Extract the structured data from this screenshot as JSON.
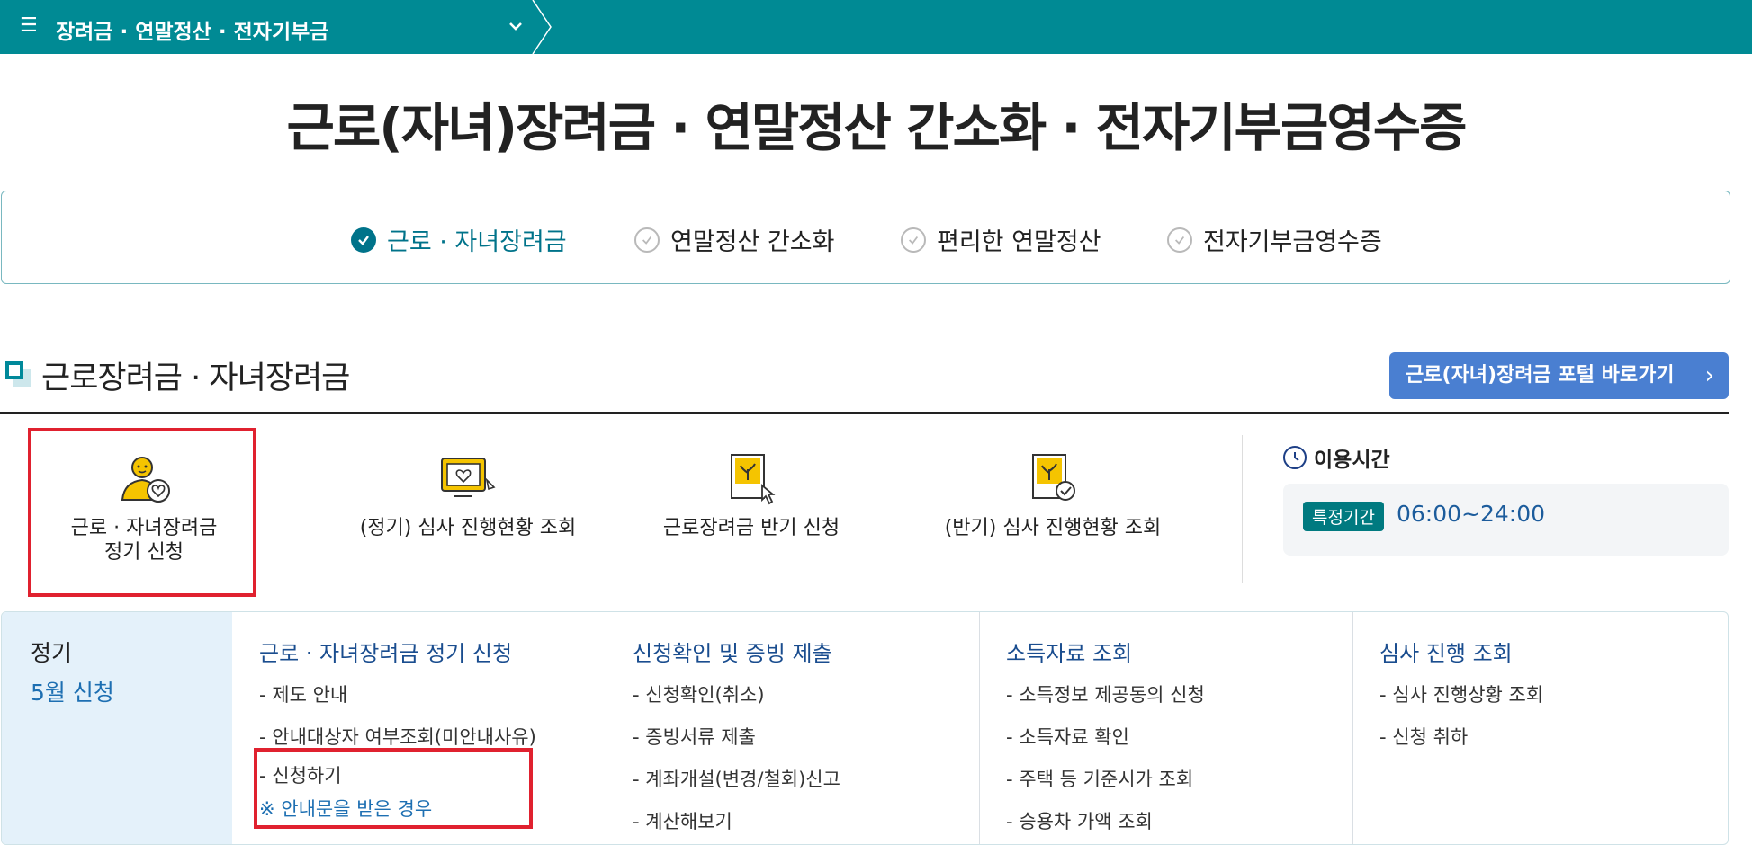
{
  "topbar": {
    "menu_title": "장려금 · 연말정산 · 전자기부금"
  },
  "page_title": "근로(자녀)장려금 · 연말정산 간소화 · 전자기부금영수증",
  "tabs": [
    {
      "label": "근로 · 자녀장려금",
      "active": true
    },
    {
      "label": "연말정산 간소화",
      "active": false
    },
    {
      "label": "편리한 연말정산",
      "active": false
    },
    {
      "label": "전자기부금영수증",
      "active": false
    }
  ],
  "section": {
    "title": "근로장려금 · 자녀장려금",
    "portal_button": "근로(자녀)장려금 포털 바로가기"
  },
  "services": [
    {
      "line1": "근로 · 자녀장려금",
      "line2": "정기 신청",
      "icon": "person-heart-icon"
    },
    {
      "line1": "(정기) 심사 진행현황 조회",
      "line2": "",
      "icon": "monitor-heart-icon"
    },
    {
      "line1": "근로장려금 반기 신청",
      "line2": "",
      "icon": "document-click-icon"
    },
    {
      "line1": "(반기) 심사 진행현황 조회",
      "line2": "",
      "icon": "document-check-icon"
    }
  ],
  "hours": {
    "heading": "이용시간",
    "badge": "특정기간",
    "value": "06:00~24:00"
  },
  "panel": {
    "left_label": "정기",
    "left_when": "5월 신청",
    "columns": [
      {
        "heading": "근로 · 자녀장려금 정기 신청",
        "items": [
          "- 제도 안내",
          "- 안내대상자 여부조회(미안내사유)",
          "- 신청하기"
        ],
        "note": "※ 안내문을 받은 경우"
      },
      {
        "heading": "신청확인 및 증빙 제출",
        "items": [
          "- 신청확인(취소)",
          "- 증빙서류 제출",
          "- 계좌개설(변경/철회)신고",
          "- 계산해보기"
        ]
      },
      {
        "heading": "소득자료 조회",
        "items": [
          "- 소득정보 제공동의 신청",
          "- 소득자료 확인",
          "- 주택 등 기준시가 조회",
          "- 승용차 가액 조회"
        ]
      },
      {
        "heading": "심사 진행 조회",
        "items": [
          "- 심사 진행상황 조회",
          "- 신청 취하"
        ]
      }
    ]
  },
  "colors": {
    "topbar": "#008a94",
    "accent": "#00738a",
    "portal_button": "#4a7fd1",
    "highlight": "#e0212f"
  }
}
